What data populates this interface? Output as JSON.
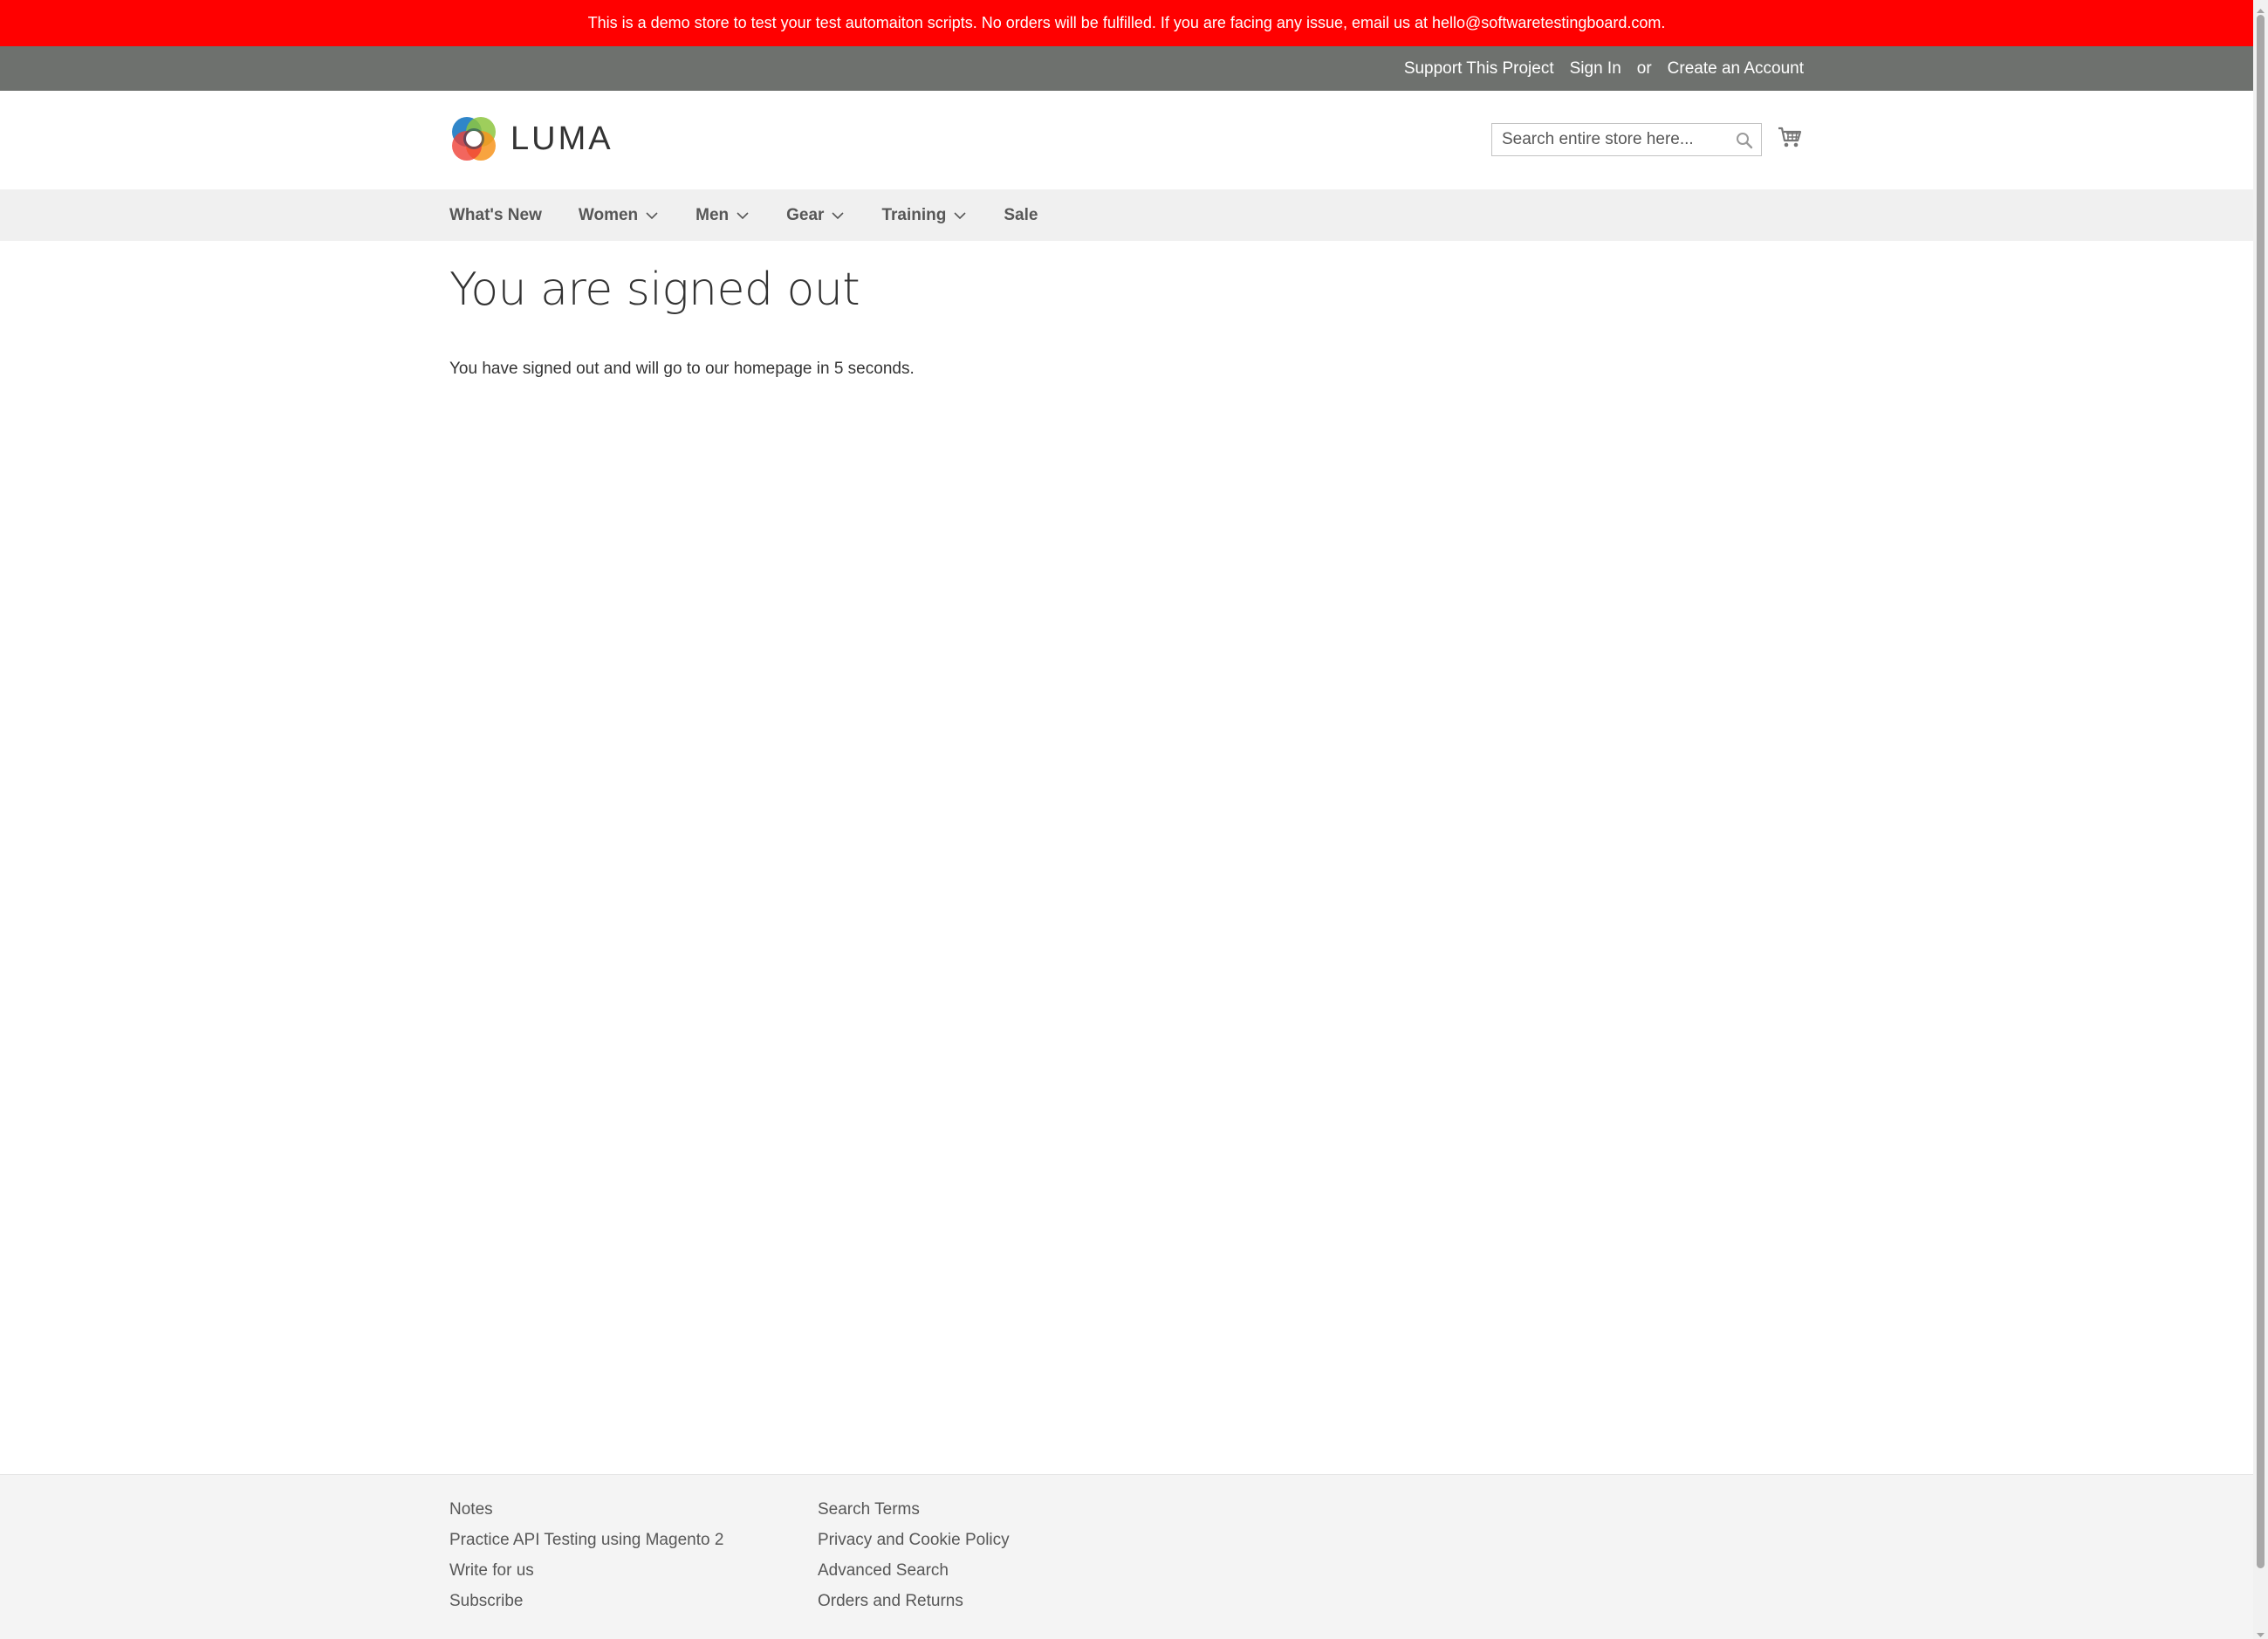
{
  "banner": {
    "text": "This is a demo store to test your test automaiton scripts. No orders will be fulfilled. If you are facing any issue, email us at hello@softwaretestingboard.com."
  },
  "top_links": {
    "support": "Support This Project",
    "sign_in": "Sign In",
    "or": "or",
    "create_account": "Create an Account"
  },
  "header": {
    "logo_text": "LUMA",
    "search_placeholder": "Search entire store here...",
    "search_icon": "search-icon",
    "cart_icon": "shopping-cart-icon"
  },
  "nav": {
    "items": [
      {
        "label": "What's New",
        "has_dropdown": false
      },
      {
        "label": "Women",
        "has_dropdown": true
      },
      {
        "label": "Men",
        "has_dropdown": true
      },
      {
        "label": "Gear",
        "has_dropdown": true
      },
      {
        "label": "Training",
        "has_dropdown": true
      },
      {
        "label": "Sale",
        "has_dropdown": false
      }
    ]
  },
  "main": {
    "title": "You are signed out",
    "message": "You have signed out and will go to our homepage in 5 seconds."
  },
  "footer": {
    "col1": [
      "Notes",
      "Practice API Testing using Magento 2",
      "Write for us",
      "Subscribe"
    ],
    "col2": [
      "Search Terms",
      "Privacy and Cookie Policy",
      "Advanced Search",
      "Orders and Returns"
    ]
  },
  "colors": {
    "banner_bg": "#ff0000",
    "top_bar_bg": "#6e716e",
    "nav_bg": "#f0f0f0",
    "footer_bg": "#f4f4f4"
  }
}
